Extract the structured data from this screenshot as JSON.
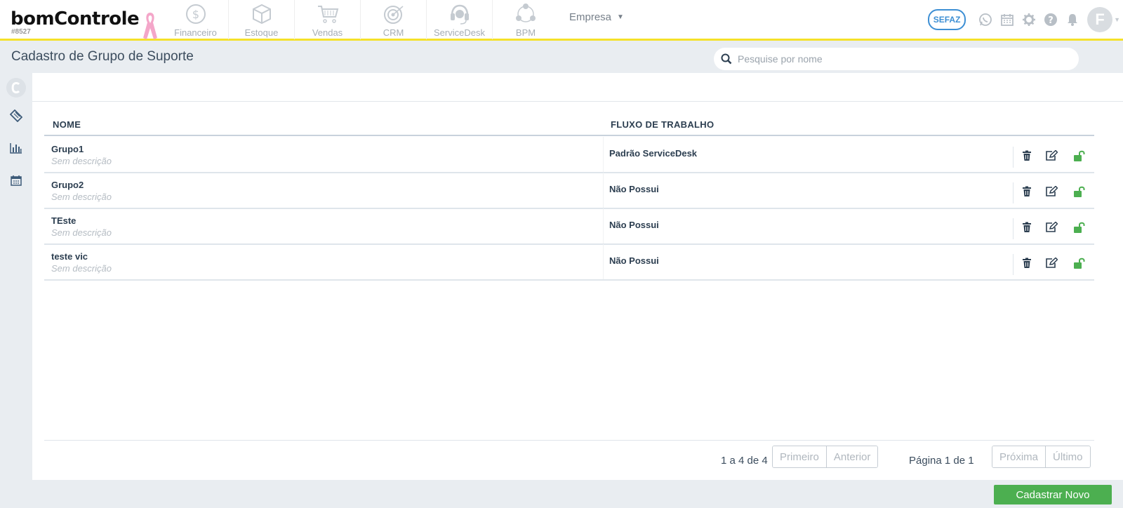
{
  "brand": {
    "name": "bomControle",
    "account_id": "#8527"
  },
  "modules": [
    {
      "label": "Financeiro",
      "icon": "dollar-coin-icon"
    },
    {
      "label": "Estoque",
      "icon": "box-icon"
    },
    {
      "label": "Vendas",
      "icon": "shopping-cart-icon"
    },
    {
      "label": "CRM",
      "icon": "target-icon"
    },
    {
      "label": "ServiceDesk",
      "icon": "headset-icon"
    },
    {
      "label": "BPM",
      "icon": "process-cycle-icon"
    }
  ],
  "company_menu": {
    "label": "Empresa"
  },
  "header_right": {
    "sefaz_label": "SEFAZ",
    "avatar_letter": "F"
  },
  "page": {
    "title": "Cadastro de Grupo de Suporte"
  },
  "search": {
    "placeholder": "Pesquise por nome",
    "value": ""
  },
  "table": {
    "columns": [
      "NOME",
      "FLUXO DE TRABALHO"
    ],
    "rows": [
      {
        "name": "Grupo1",
        "description": "Sem descrição",
        "workflow": "Padrão ServiceDesk"
      },
      {
        "name": "Grupo2",
        "description": "Sem descrição",
        "workflow": "Não Possui"
      },
      {
        "name": "TEste",
        "description": "Sem descrição",
        "workflow": "Não Possui"
      },
      {
        "name": "teste vic",
        "description": "Sem descrição",
        "workflow": "Não Possui"
      }
    ]
  },
  "pagination": {
    "count_text": "1 a 4 de 4",
    "first_label": "Primeiro",
    "prev_label": "Anterior",
    "page_text": "Página 1 de 1",
    "next_label": "Próxima",
    "last_label": "Último"
  },
  "actions": {
    "new_label": "Cadastrar Novo"
  },
  "colors": {
    "accent_yellow": "#f5e12a",
    "primary_green": "#4caf50",
    "unlock_green": "#4caf50",
    "text_dark": "#2c3e50",
    "sefaz_blue": "#3d8fd4"
  }
}
